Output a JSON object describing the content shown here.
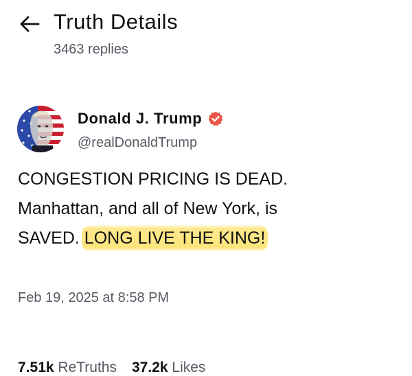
{
  "header": {
    "title": "Truth Details",
    "replies": "3463 replies"
  },
  "post": {
    "author": {
      "name": "Donald J. Trump",
      "handle": "@realDonaldTrump",
      "verified": true
    },
    "text_lines": [
      "CONGESTION PRICING IS DEAD.",
      "Manhattan, and all of New York, is",
      "SAVED."
    ],
    "highlighted_text": "LONG LIVE THE KING!",
    "stats": {
      "retruths_count": "7.51k",
      "retruths_label": "ReTruths",
      "likes_count": "37.2k",
      "likes_label": "Likes"
    },
    "timestamp": "Feb 19, 2025 at 8:58 PM"
  },
  "colors": {
    "verified_badge": "#e9574a",
    "highlight": "#fde278",
    "secondary_text": "#555a63"
  },
  "icons": {
    "back": "arrow-left-icon",
    "verified": "verified-badge-icon"
  }
}
